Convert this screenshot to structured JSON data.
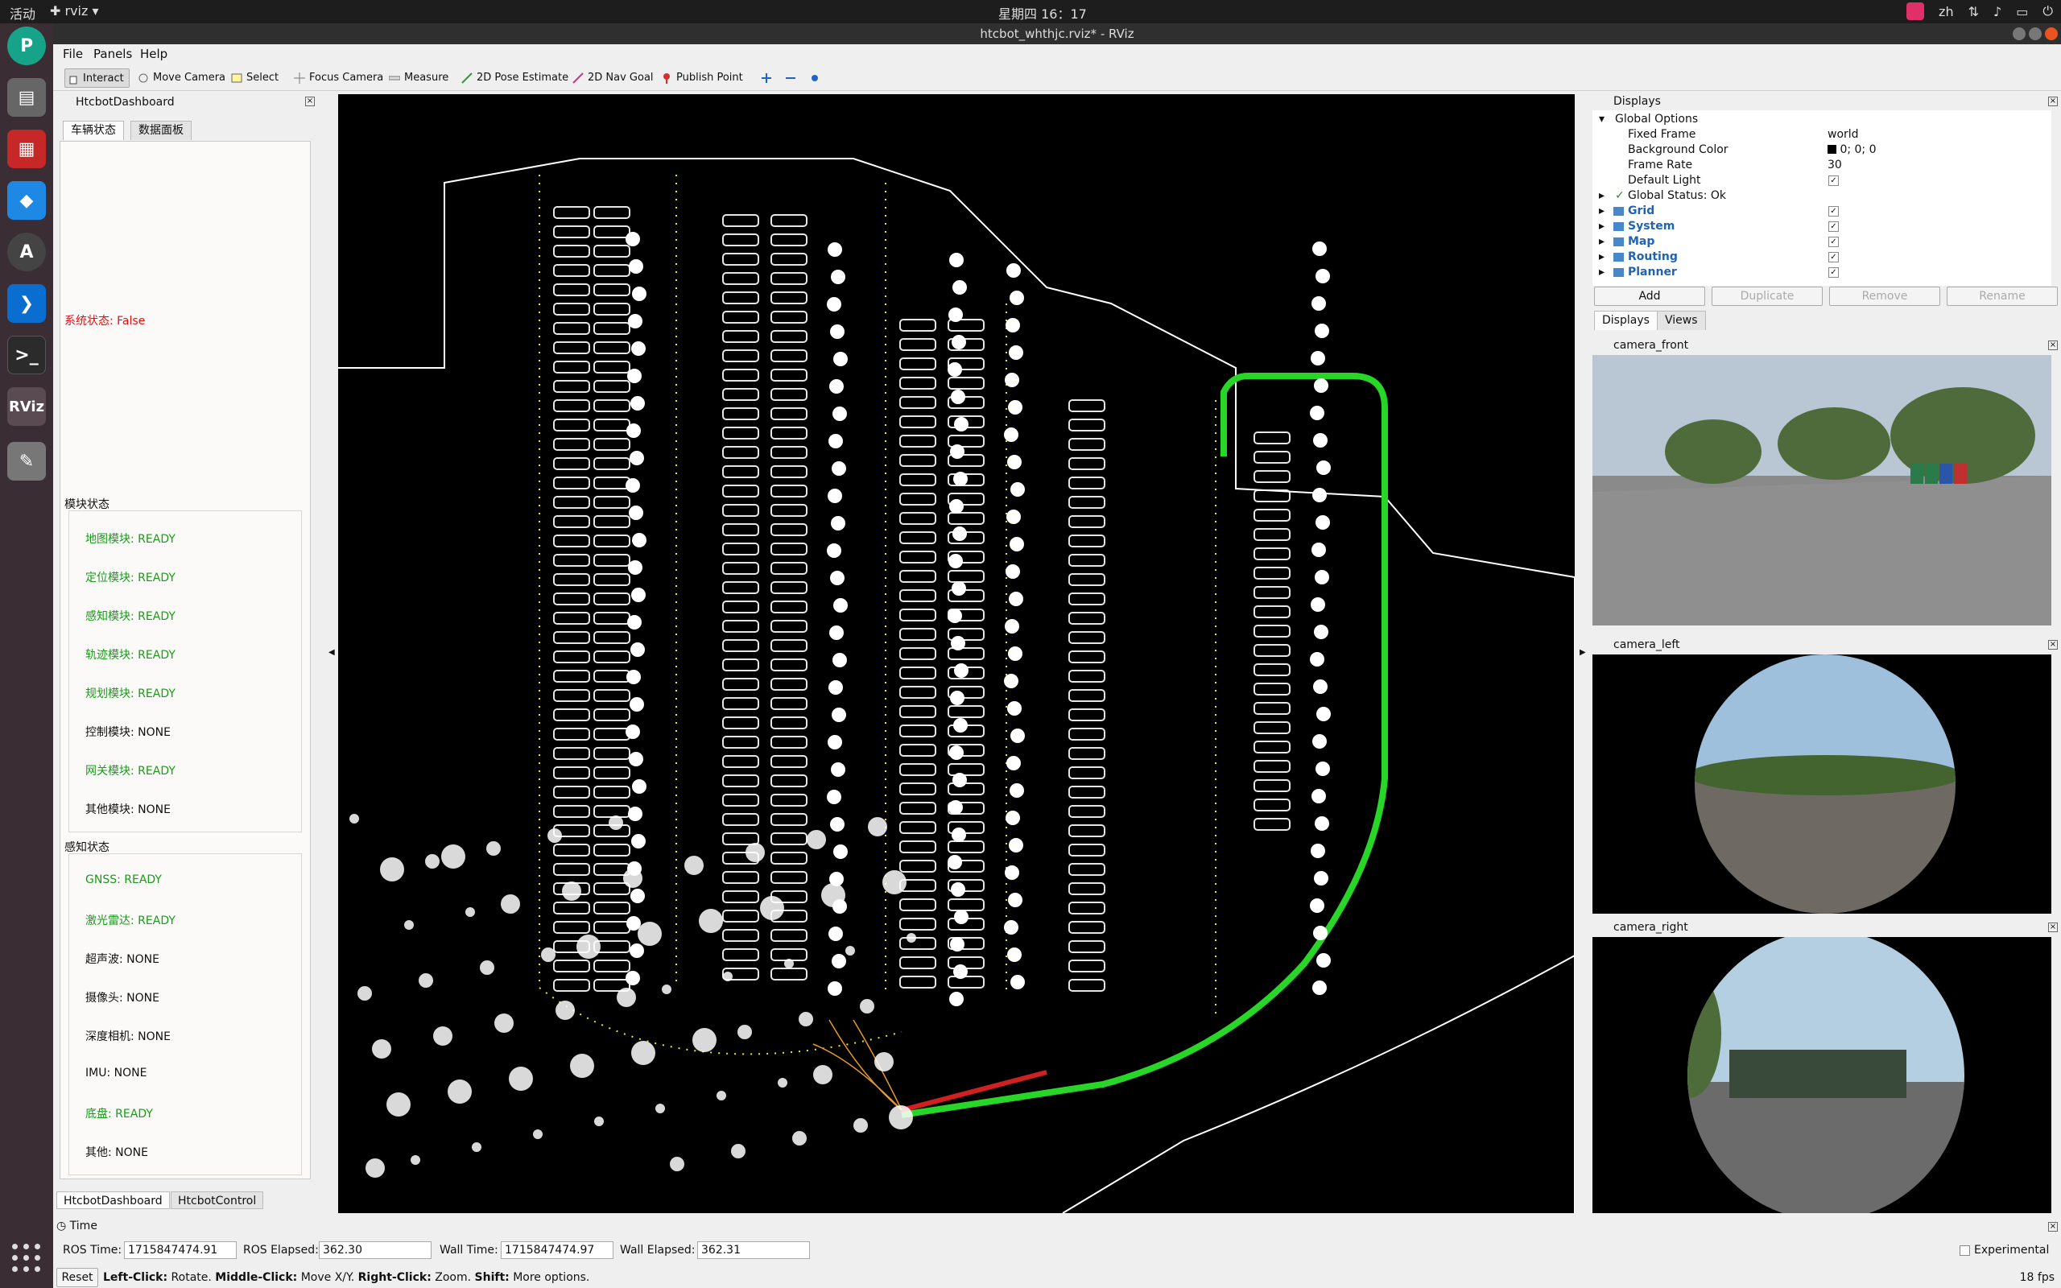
{
  "topbar": {
    "activities": "活动",
    "app_name": "rviz",
    "clock": "星期四 16：17",
    "lang": "zh"
  },
  "window": {
    "title": "htcbot_whthjc.rviz* - RViz"
  },
  "menu": {
    "file": "File",
    "panels": "Panels",
    "help": "Help"
  },
  "toolbar": {
    "interact": "Interact",
    "move_camera": "Move Camera",
    "select": "Select",
    "focus_camera": "Focus Camera",
    "measure": "Measure",
    "pose_estimate": "2D Pose Estimate",
    "nav_goal": "2D Nav Goal",
    "publish_point": "Publish Point"
  },
  "dashboard": {
    "title": "HtcbotDashboard",
    "tabs": [
      "车辆状态",
      "数据面板"
    ],
    "system_status": "系统状态: False",
    "module_group": "模块状态",
    "modules": [
      {
        "text": "地图模块: READY",
        "state": "ok"
      },
      {
        "text": "定位模块: READY",
        "state": "ok"
      },
      {
        "text": "感知模块: READY",
        "state": "ok"
      },
      {
        "text": "轨迹模块: READY",
        "state": "ok"
      },
      {
        "text": "规划模块: READY",
        "state": "ok"
      },
      {
        "text": "控制模块: NONE",
        "state": "none"
      },
      {
        "text": "网关模块: READY",
        "state": "ok"
      },
      {
        "text": "其他模块: NONE",
        "state": "none"
      }
    ],
    "sensor_group": "感知状态",
    "sensors": [
      {
        "text": "GNSS: READY",
        "state": "ok"
      },
      {
        "text": "激光雷达: READY",
        "state": "ok"
      },
      {
        "text": "超声波: NONE",
        "state": "none"
      },
      {
        "text": "摄像头: NONE",
        "state": "none"
      },
      {
        "text": "深度相机: NONE",
        "state": "none"
      },
      {
        "text": "IMU: NONE",
        "state": "none"
      },
      {
        "text": "底盘: READY",
        "state": "ok"
      },
      {
        "text": "其他: NONE",
        "state": "none"
      }
    ],
    "bottom_tabs": [
      "HtcbotDashboard",
      "HtcbotControl"
    ]
  },
  "displays": {
    "title": "Displays",
    "global_options": "Global Options",
    "fixed_frame": {
      "label": "Fixed Frame",
      "value": "world"
    },
    "background_color": {
      "label": "Background Color",
      "value": "0; 0; 0"
    },
    "frame_rate": {
      "label": "Frame Rate",
      "value": "30"
    },
    "default_light": {
      "label": "Default Light"
    },
    "global_status": "Global Status: Ok",
    "items": [
      "Grid",
      "System",
      "Map",
      "Routing",
      "Planner"
    ],
    "buttons": {
      "add": "Add",
      "duplicate": "Duplicate",
      "remove": "Remove",
      "rename": "Rename"
    },
    "tabs": [
      "Displays",
      "Views"
    ]
  },
  "cameras": {
    "front": "camera_front",
    "left": "camera_left",
    "right": "camera_right"
  },
  "time": {
    "title": "Time",
    "ros_time_label": "ROS Time:",
    "ros_time": "1715847474.91",
    "ros_elapsed_label": "ROS Elapsed:",
    "ros_elapsed": "362.30",
    "wall_time_label": "Wall Time:",
    "wall_time": "1715847474.97",
    "wall_elapsed_label": "Wall Elapsed:",
    "wall_elapsed": "362.31",
    "experimental": "Experimental"
  },
  "status": {
    "reset": "Reset",
    "hint_left_key": "Left-Click:",
    "hint_left": "Rotate.",
    "hint_mid_key": "Middle-Click:",
    "hint_mid": "Move X/Y.",
    "hint_right_key": "Right-Click:",
    "hint_right": "Zoom.",
    "hint_shift_key": "Shift:",
    "hint_shift": "More options.",
    "fps": "18 fps"
  }
}
